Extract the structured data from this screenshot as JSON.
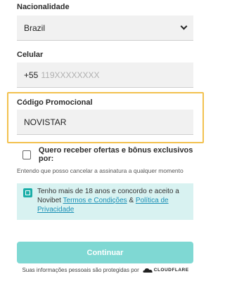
{
  "nationality": {
    "label": "Nacionalidade",
    "value": "Brazil"
  },
  "phone": {
    "label": "Celular",
    "prefix": "+55",
    "placeholder": "119XXXXXXXX"
  },
  "promo": {
    "label": "Código Promocional",
    "value": "NOVISTAR",
    "highlight_color": "#f2c14e"
  },
  "offers": {
    "label": "Quero receber ofertas e bônus exclusivos por:",
    "checked": false
  },
  "cancel_note": "Entendo que posso cancelar a assinatura a qualquer momento",
  "age_consent": {
    "checked": true,
    "text_before": "Tenho mais de 18 anos e concordo e aceito a Novibet ",
    "terms_link": "Termos e Condições",
    "conjunction": " & ",
    "privacy_link": "Política de Privacidade",
    "background": "#d8f2f1",
    "accent": "#1aaea8"
  },
  "continue_button": {
    "label": "Continuar",
    "color": "#7fd8d3"
  },
  "footer": {
    "text": "Suas informações pessoais são protegidas por",
    "brand": "CLOUDFLARE",
    "icon": "cloudflare-cloud-icon"
  }
}
